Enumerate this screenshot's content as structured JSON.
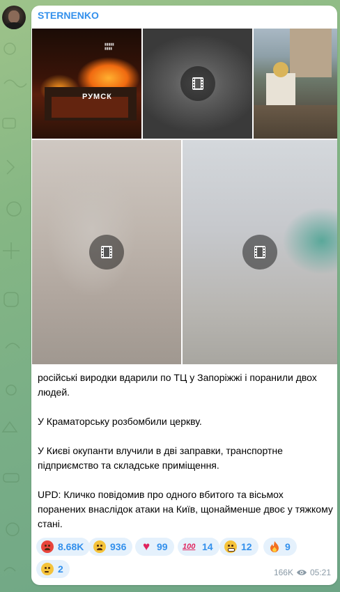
{
  "channel": {
    "name": "STERNENKO"
  },
  "media": [
    {
      "kind": "photo",
      "sign_text": "РУМСК"
    },
    {
      "kind": "video",
      "icon": "film-icon"
    },
    {
      "kind": "photo"
    },
    {
      "kind": "video",
      "icon": "film-icon"
    },
    {
      "kind": "video",
      "icon": "film-icon"
    }
  ],
  "message": {
    "paragraphs": [
      "російські виродки вдарили по ТЦ у Запоріжжі і поранили двох людей.",
      "У Краматорську розбомбили церкву.",
      "У Києві окупанти влучили в дві заправки, транспортне підприємство та складське приміщення.",
      "UPD: Кличко повідомив про одного вбитого та вісьмох поранених внаслідок атаки на Київ, щонайменше двоє у тяжкому стані."
    ]
  },
  "reactions": [
    {
      "emoji": "angry-face",
      "count": "8.68K",
      "color": "#e8453c"
    },
    {
      "emoji": "crying-face",
      "count": "936",
      "color": "#f5c33b"
    },
    {
      "emoji": "red-heart",
      "count": "99",
      "color": "#e0245e"
    },
    {
      "emoji": "hundred-points",
      "count": "14",
      "color": "#e0245e"
    },
    {
      "emoji": "grimacing-face",
      "count": "12",
      "color": "#f5c33b"
    },
    {
      "emoji": "fire",
      "count": "9",
      "color": "#f26f21"
    },
    {
      "emoji": "thinking-face",
      "count": "2",
      "color": "#f5c33b"
    }
  ],
  "meta": {
    "views": "166K",
    "time": "05:21"
  },
  "colors": {
    "accent": "#3390ec",
    "reaction_bg": "#e5f1fc"
  }
}
